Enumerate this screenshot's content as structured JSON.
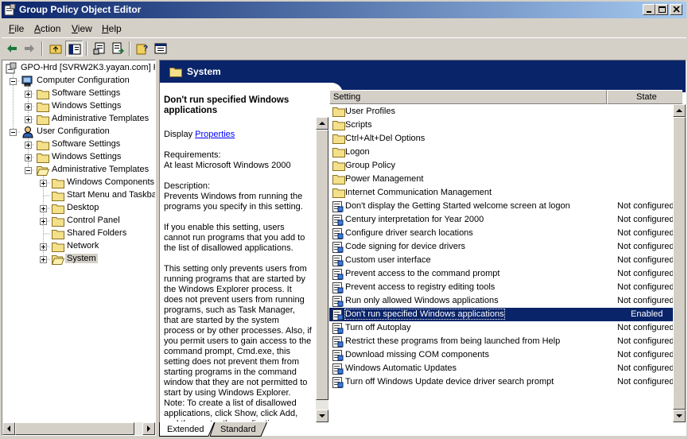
{
  "window": {
    "title": "Group Policy Object Editor",
    "colors": {
      "titlebar": "#0a246a",
      "selection": "#0a246a",
      "face": "#d4d0c8",
      "link": "#0000ff"
    }
  },
  "menu": {
    "file": {
      "key": "F",
      "rest": "ile"
    },
    "action": {
      "key": "A",
      "rest": "ction"
    },
    "view": {
      "key": "V",
      "rest": "iew"
    },
    "help": {
      "key": "H",
      "rest": "elp"
    }
  },
  "toolbar": {
    "icons": [
      "back-arrow-icon",
      "forward-arrow-icon",
      "up-folder-icon",
      "show-hide-tree-icon",
      "properties-icon",
      "export-list-icon",
      "help-icon",
      "show-hide-description-icon"
    ]
  },
  "tree": {
    "root": "GPO-Hrd [SVRW2K3.yayan.com] P",
    "computer_configuration": "Computer Configuration",
    "cc_software_settings": "Software Settings",
    "cc_windows_settings": "Windows Settings",
    "cc_administrative_templates": "Administrative Templates",
    "user_configuration": "User Configuration",
    "uc_software_settings": "Software Settings",
    "uc_windows_settings": "Windows Settings",
    "uc_administrative_templates": "Administrative Templates",
    "windows_components": "Windows Components",
    "start_menu": "Start Menu and Taskba",
    "desktop": "Desktop",
    "control_panel": "Control Panel",
    "shared_folders": "Shared Folders",
    "network": "Network",
    "system": "System"
  },
  "header": {
    "title": "System"
  },
  "description": {
    "title": "Don't run specified Windows applications",
    "display_prefix": "Display ",
    "properties_link": "Properties",
    "requirements_label": "Requirements:",
    "requirements_value": "At least Microsoft Windows 2000",
    "description_label": "Description:",
    "para1": "Prevents Windows from running the programs you specify in this setting.",
    "para2": "If you enable this setting, users cannot run programs that you add to the list of disallowed applications.",
    "para3": "This setting only prevents users from running programs that are started by the Windows Explorer process. It does not prevent users from running programs, such as Task Manager, that are started by the system process or by other processes. Also, if you permit users to gain access to the command prompt, Cmd.exe, this setting does not prevent them from starting programs in the command window that they are not permitted to start by using Windows Explorer.",
    "para4": "Note: To create a list of disallowed applications, click Show, click Add, and then enter the application"
  },
  "list": {
    "columns": {
      "setting": "Setting",
      "state": "State"
    },
    "rows": [
      {
        "name": "User Profiles",
        "state": "",
        "icon": "folder-icon"
      },
      {
        "name": "Scripts",
        "state": "",
        "icon": "folder-icon"
      },
      {
        "name": "Ctrl+Alt+Del Options",
        "state": "",
        "icon": "folder-icon"
      },
      {
        "name": "Logon",
        "state": "",
        "icon": "folder-icon"
      },
      {
        "name": "Group Policy",
        "state": "",
        "icon": "folder-icon"
      },
      {
        "name": "Power Management",
        "state": "",
        "icon": "folder-icon"
      },
      {
        "name": "Internet Communication Management",
        "state": "",
        "icon": "folder-icon"
      },
      {
        "name": "Don't display the Getting Started welcome screen at logon",
        "state": "Not configured",
        "icon": "policy-setting-icon"
      },
      {
        "name": "Century interpretation for Year 2000",
        "state": "Not configured",
        "icon": "policy-setting-icon"
      },
      {
        "name": "Configure driver search locations",
        "state": "Not configured",
        "icon": "policy-setting-icon"
      },
      {
        "name": "Code signing for device drivers",
        "state": "Not configured",
        "icon": "policy-setting-icon"
      },
      {
        "name": "Custom user interface",
        "state": "Not configured",
        "icon": "policy-setting-icon"
      },
      {
        "name": "Prevent access to the command prompt",
        "state": "Not configured",
        "icon": "policy-setting-icon"
      },
      {
        "name": "Prevent access to registry editing tools",
        "state": "Not configured",
        "icon": "policy-setting-icon"
      },
      {
        "name": "Run only allowed Windows applications",
        "state": "Not configured",
        "icon": "policy-setting-icon"
      },
      {
        "name": "Don't run specified Windows applications",
        "state": "Enabled",
        "icon": "policy-setting-icon",
        "selected": true
      },
      {
        "name": "Turn off Autoplay",
        "state": "Not configured",
        "icon": "policy-setting-icon"
      },
      {
        "name": "Restrict these programs from being launched from Help",
        "state": "Not configured",
        "icon": "policy-setting-icon"
      },
      {
        "name": "Download missing COM components",
        "state": "Not configured",
        "icon": "policy-setting-icon"
      },
      {
        "name": "Windows Automatic Updates",
        "state": "Not configured",
        "icon": "policy-setting-icon"
      },
      {
        "name": "Turn off Windows Update device driver search prompt",
        "state": "Not configured",
        "icon": "policy-setting-icon"
      }
    ]
  },
  "tabs": {
    "extended": "Extended",
    "standard": "Standard"
  }
}
